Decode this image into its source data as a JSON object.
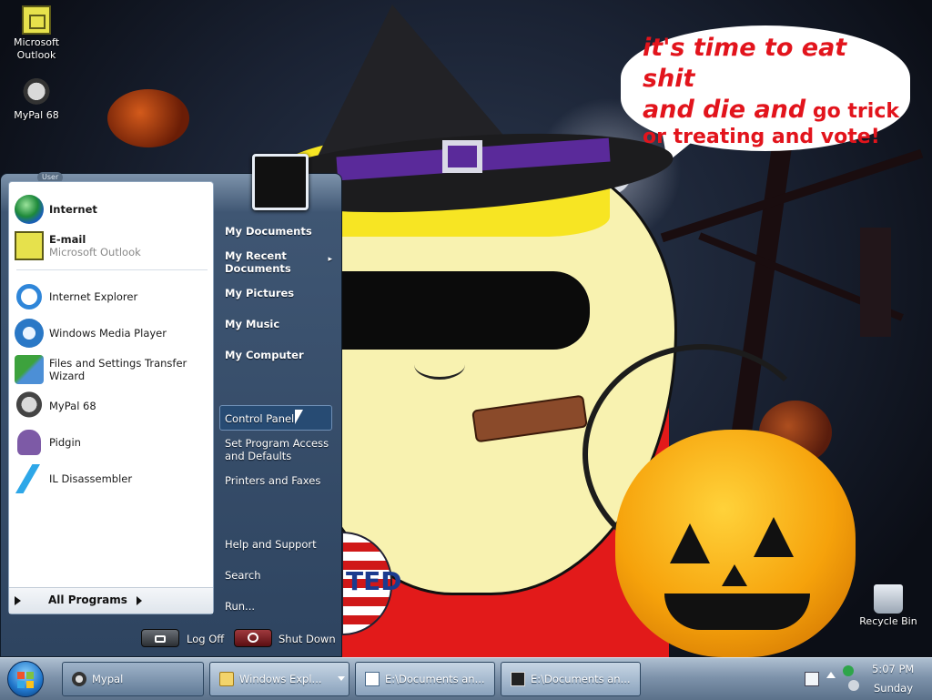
{
  "wallpaper": {
    "speech_line1": "it's time to eat shit",
    "speech_line2a": "and die and",
    "speech_line2b": " go trick",
    "speech_line3": "or treating and vote!",
    "badge_text": "TED"
  },
  "desktop_icons": [
    {
      "label": "Microsoft Outlook",
      "icon": "outlook-icon"
    },
    {
      "label": "MyPal 68",
      "icon": "raccoon-icon"
    },
    {
      "label": "Recycle Bin",
      "icon": "recycle-bin-icon"
    }
  ],
  "start_menu": {
    "user_pill": "User",
    "pinned": [
      {
        "label": "Internet",
        "bold": true,
        "icon": "globe-icon"
      },
      {
        "label": "E-mail",
        "sub": "Microsoft Outlook",
        "bold": true,
        "icon": "outlook-icon"
      }
    ],
    "recent": [
      {
        "label": "Internet Explorer",
        "icon": "internet-explorer-icon"
      },
      {
        "label": "Windows Media Player",
        "icon": "media-player-icon"
      },
      {
        "label": "Files and Settings Transfer Wizard",
        "icon": "transfer-wizard-icon"
      },
      {
        "label": "MyPal 68",
        "icon": "raccoon-icon"
      },
      {
        "label": "Pidgin",
        "icon": "pidgin-icon"
      },
      {
        "label": "IL Disassembler",
        "icon": "lightning-icon"
      }
    ],
    "all_programs": "All Programs",
    "right_links": [
      {
        "label": "My Documents"
      },
      {
        "label": "My Recent Documents",
        "has_submenu": true
      },
      {
        "label": "My Pictures"
      },
      {
        "label": "My Music"
      },
      {
        "label": "My Computer"
      },
      {
        "label": "Control Panel",
        "selected": true
      },
      {
        "label": "Set Program Access and Defaults"
      },
      {
        "label": "Printers and Faxes"
      },
      {
        "label": "Help and Support"
      },
      {
        "label": "Search"
      },
      {
        "label": "Run..."
      }
    ],
    "log_off": "Log Off",
    "shut_down": "Shut Down"
  },
  "taskbar": {
    "tasks": [
      {
        "label": "Mypal",
        "icon": "raccoon-icon"
      },
      {
        "label": "Windows Expl...",
        "icon": "folder-icon"
      },
      {
        "label": "E:\\Documents an...",
        "icon": "notepad-icon"
      },
      {
        "label": "E:\\Documents an...",
        "icon": "7zip-icon"
      }
    ],
    "clock_time": "5:07 PM",
    "clock_day": "Sunday"
  },
  "colors": {
    "speech_text": "#e2141c",
    "start_menu_bg": "#2e4460",
    "taskbar_bg": "#7e93ab"
  }
}
